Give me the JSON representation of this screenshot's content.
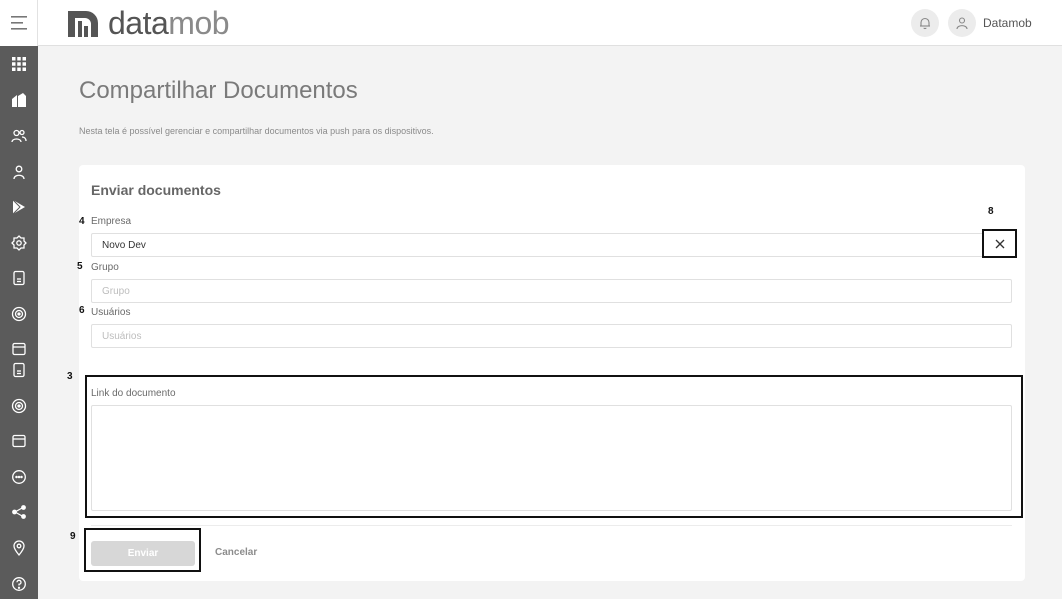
{
  "header": {
    "logo_text_bold": "data",
    "logo_text_light": "mob",
    "user_name": "Datamob"
  },
  "page": {
    "title": "Compartilhar Documentos",
    "description": "Nesta tela é possível gerenciar e compartilhar documentos via push para os dispositivos."
  },
  "form": {
    "card_title": "Enviar documentos",
    "empresa": {
      "label": "Empresa",
      "value": "Novo Dev"
    },
    "grupo": {
      "label": "Grupo",
      "placeholder": "Grupo"
    },
    "usuarios": {
      "label": "Usuários",
      "placeholder": "Usuários"
    },
    "link": {
      "label": "Link do documento"
    },
    "send_label": "Enviar",
    "cancel_label": "Cancelar"
  },
  "annotations": {
    "n3": "3",
    "n4": "4",
    "n5": "5",
    "n6": "6",
    "n8": "8",
    "n9": "9"
  },
  "sidebar_icons": [
    "menu-icon",
    "apps-grid-icon",
    "home-icon",
    "users-icon",
    "user-icon",
    "play-store-icon",
    "settings-icon",
    "document-icon",
    "radar-icon",
    "calendar-icon",
    "document-icon",
    "radar-icon",
    "calendar-icon",
    "chat-icon",
    "share-icon",
    "location-icon",
    "help-icon"
  ],
  "colors": {
    "sidebar": "#5b5b5b",
    "background": "#f3f3f3",
    "button_disabled": "#d7d7d7"
  }
}
